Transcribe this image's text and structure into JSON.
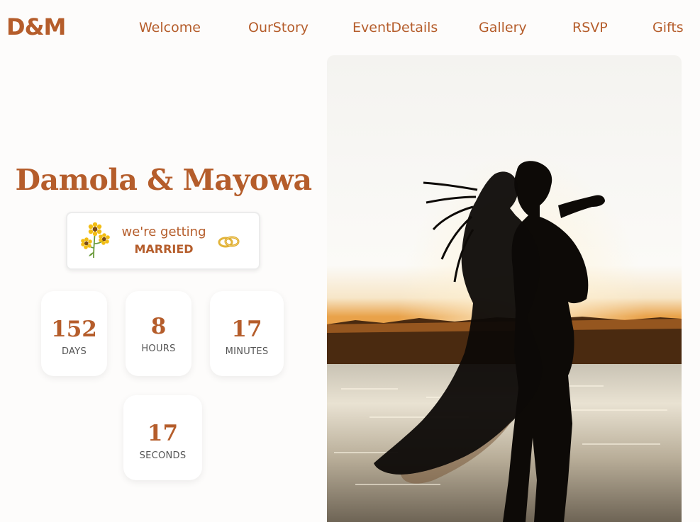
{
  "header": {
    "logo": "D&M",
    "nav": [
      {
        "label": "Welcome"
      },
      {
        "label": "OurStory"
      },
      {
        "label": "EventDetails"
      },
      {
        "label": "Gallery"
      },
      {
        "label": "RSVP"
      },
      {
        "label": "Gifts"
      }
    ]
  },
  "hero": {
    "couple_names": "Damola & Mayowa",
    "tagline_line1": "we're getting",
    "tagline_line2": "MARRIED",
    "tagline_icons": [
      "sunflower-icon",
      "wedding-rings-icon"
    ],
    "photo": "couple-silhouette-sunset-photo"
  },
  "countdown": {
    "days": {
      "value": "152",
      "label": "DAYS"
    },
    "hours": {
      "value": "8",
      "label": "HOURS"
    },
    "minutes": {
      "value": "17",
      "label": "MINUTES"
    },
    "seconds": {
      "value": "17",
      "label": "SECONDS"
    }
  },
  "colors": {
    "accent": "#b55d2b",
    "background": "#fdfcfb",
    "card": "#ffffff"
  }
}
